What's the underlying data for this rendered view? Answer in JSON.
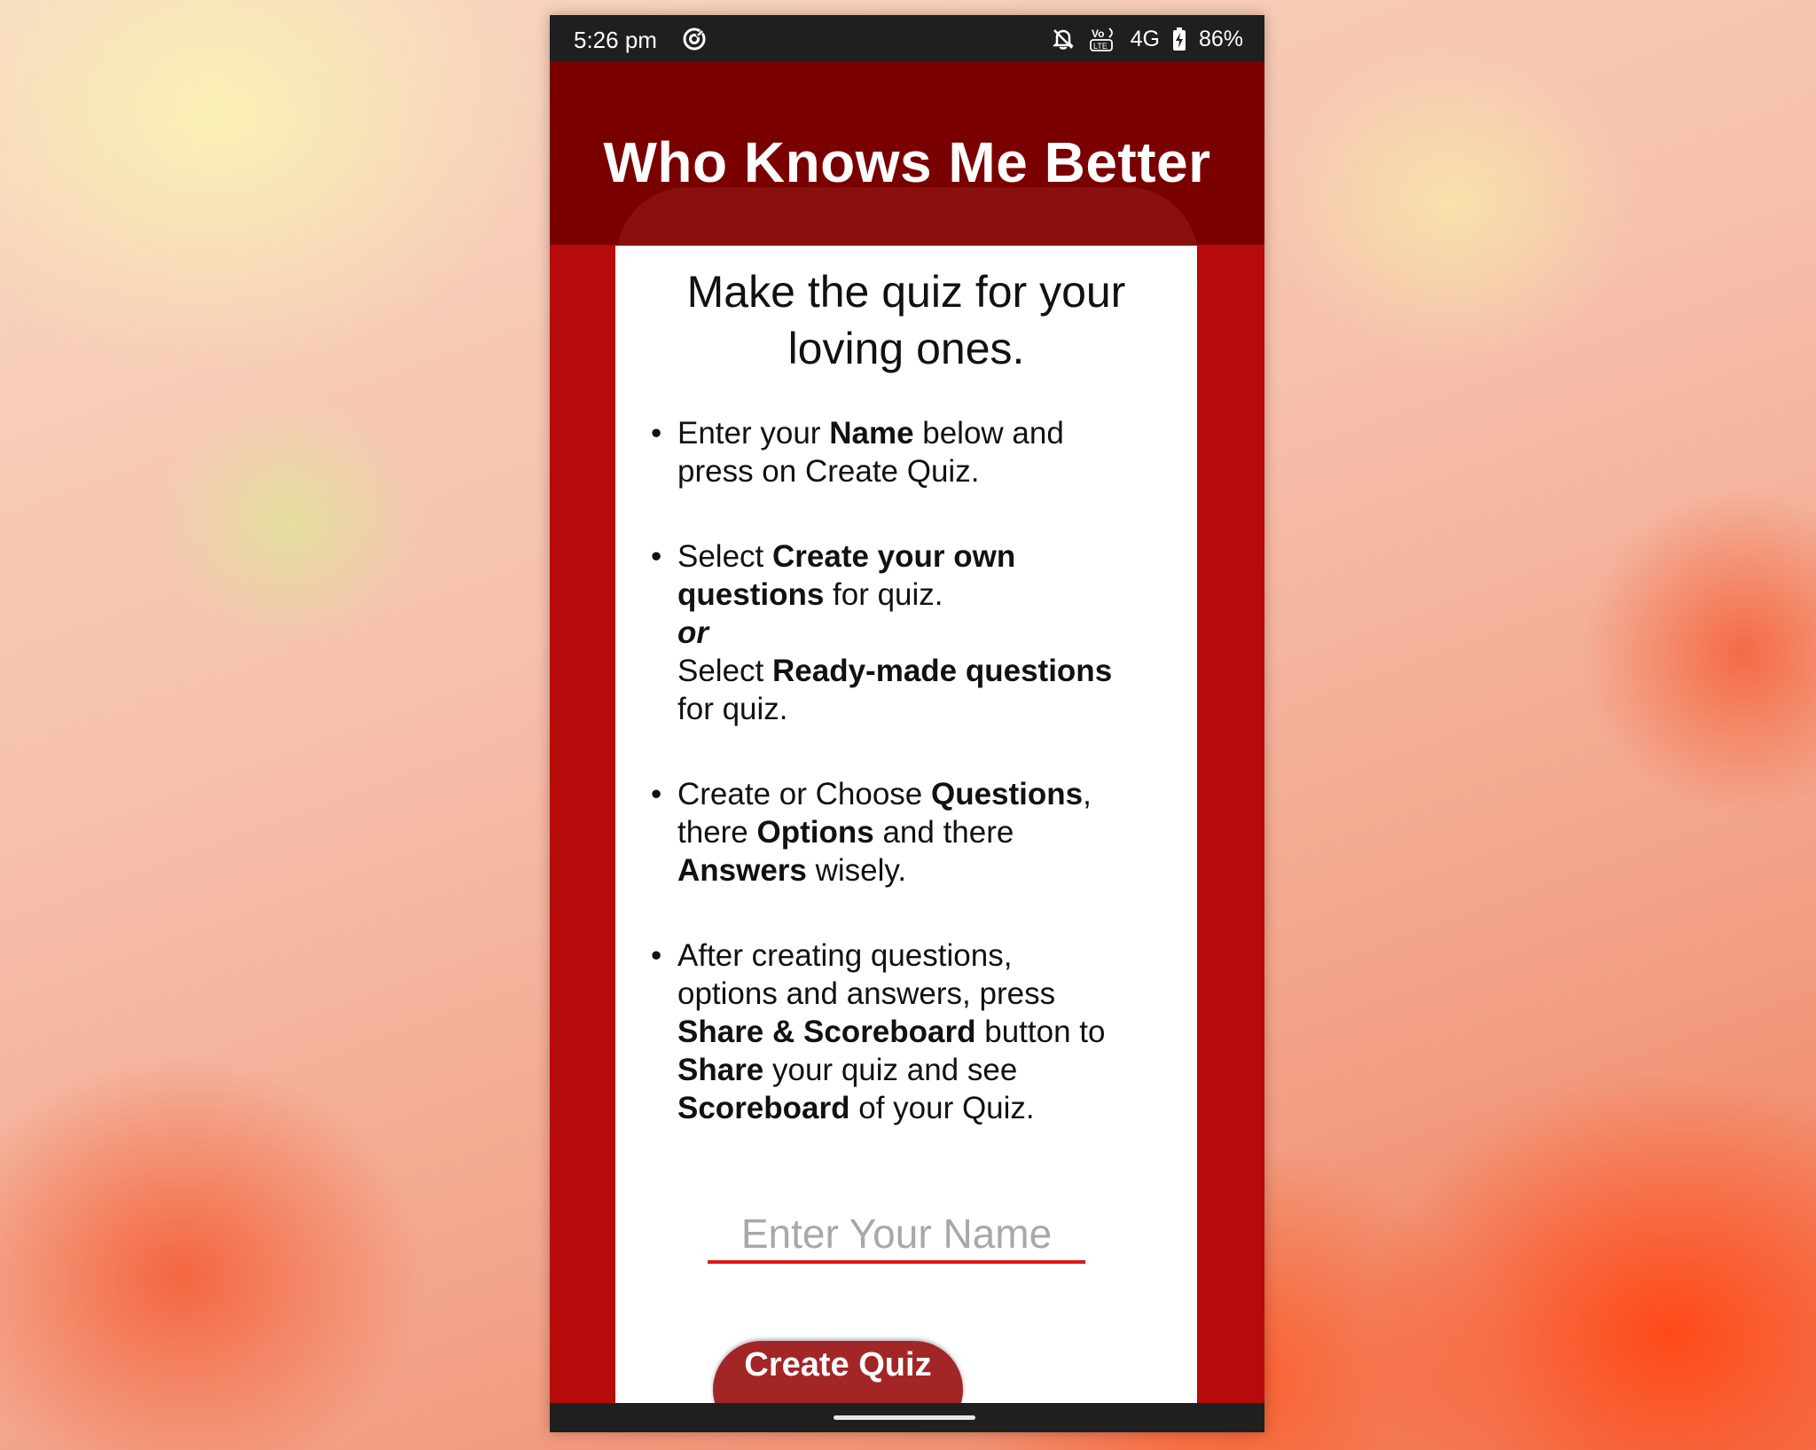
{
  "status_bar": {
    "time": "5:26 pm",
    "network": "4G",
    "battery": "86%",
    "icons": [
      "sync-icon",
      "bell-off-icon",
      "volte-icon",
      "battery-charging-icon"
    ]
  },
  "app": {
    "title": "Who Knows Me Better"
  },
  "card": {
    "heading_line1": "Make the quiz for your",
    "heading_line2": "loving ones.",
    "steps": [
      {
        "parts": [
          "Enter your ",
          "Name",
          " below and",
          "press on Create Quiz."
        ]
      },
      {
        "parts": [
          "Select ",
          "Create your own",
          "questions",
          " for quiz.",
          "or",
          "Select ",
          "Ready-made questions",
          "for quiz."
        ]
      },
      {
        "parts": [
          "Create or Choose ",
          "Questions",
          ",",
          "there ",
          "Options",
          " and there",
          "Answers",
          " wisely."
        ]
      },
      {
        "parts": [
          "After creating questions,",
          "options and answers, press",
          "Share & Scoreboard",
          " button to",
          "Share",
          " your quiz and see",
          "Scoreboard",
          " of your Quiz."
        ]
      }
    ],
    "bullet": "•",
    "name_input": {
      "placeholder": "Enter Your Name",
      "value": ""
    },
    "create_button_label": "Create Quiz"
  },
  "colors": {
    "header": "#7a0000",
    "frame": "#b70a0a",
    "button": "#a32626",
    "input_underline": "#e01818"
  }
}
